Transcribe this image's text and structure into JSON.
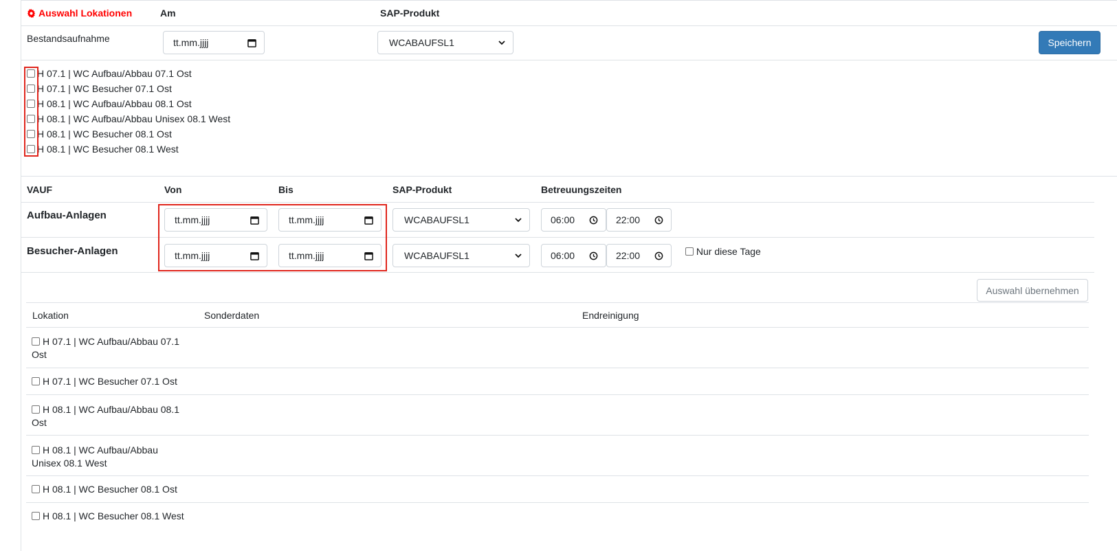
{
  "header": {
    "title": "Auswahl Lokationen",
    "col_am": "Am",
    "col_sap": "SAP-Produkt"
  },
  "bestandsaufnahme": {
    "label": "Bestandsaufnahme",
    "date_placeholder": "tt.mm.jjjj",
    "sap_value": "WCABAUFSL1",
    "save_label": "Speichern"
  },
  "locations": [
    "H 07.1 | WC Aufbau/Abbau 07.1 Ost",
    "H 07.1 | WC Besucher 07.1 Ost",
    "H 08.1 | WC Aufbau/Abbau 08.1 Ost",
    "H 08.1 | WC Aufbau/Abbau Unisex 08.1 West",
    "H 08.1 | WC Besucher 08.1 Ost",
    "H 08.1 | WC Besucher 08.1 West"
  ],
  "vauf": {
    "headers": {
      "vauf": "VAUF",
      "von": "Von",
      "bis": "Bis",
      "sap": "SAP-Produkt",
      "betreuung": "Betreuungszeiten"
    },
    "rows": [
      {
        "label": "Aufbau-Anlagen",
        "von": "tt.mm.jjjj",
        "bis": "tt.mm.jjjj",
        "sap": "WCABAUFSL1",
        "time_from": "06:00",
        "time_to": "22:00"
      },
      {
        "label": "Besucher-Anlagen",
        "von": "tt.mm.jjjj",
        "bis": "tt.mm.jjjj",
        "sap": "WCABAUFSL1",
        "time_from": "06:00",
        "time_to": "22:00"
      }
    ],
    "nur_diese_tage": "Nur diese Tage",
    "apply_label": "Auswahl übernehmen"
  },
  "table": {
    "headers": {
      "lokation": "Lokation",
      "sonderdaten": "Sonderdaten",
      "endreinigung": "Endreinigung"
    },
    "rows": [
      "H 07.1 | WC Aufbau/Abbau 07.1 Ost",
      "H 07.1 | WC Besucher 07.1 Ost",
      "H 08.1 | WC Aufbau/Abbau 08.1 Ost",
      "H 08.1 | WC Aufbau/Abbau Unisex 08.1 West",
      "H 08.1 | WC Besucher 08.1 Ost",
      "H 08.1 | WC Besucher 08.1 West"
    ]
  },
  "colors": {
    "accent_red": "#ff0000",
    "primary_button": "#337ab7",
    "highlight_box": "#e0241b"
  }
}
